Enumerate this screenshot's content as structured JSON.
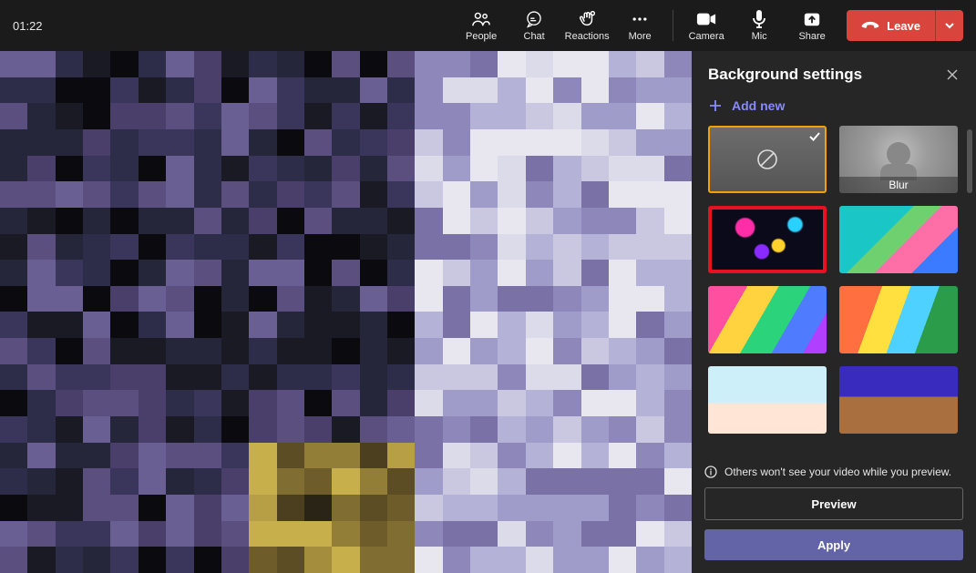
{
  "call": {
    "duration": "01:22"
  },
  "toolbar": {
    "people": "People",
    "chat": "Chat",
    "reactions": "Reactions",
    "more": "More",
    "camera": "Camera",
    "mic": "Mic",
    "share": "Share",
    "leave": "Leave"
  },
  "panel": {
    "title": "Background settings",
    "add_new": "Add new",
    "thumbs": [
      {
        "name": "none",
        "label": "",
        "selected": true,
        "highlighted": false
      },
      {
        "name": "blur",
        "label": "Blur",
        "selected": false,
        "highlighted": false
      },
      {
        "name": "image-1",
        "label": "",
        "selected": false,
        "highlighted": true
      },
      {
        "name": "image-2",
        "label": "",
        "selected": false,
        "highlighted": false
      },
      {
        "name": "image-3",
        "label": "",
        "selected": false,
        "highlighted": false
      },
      {
        "name": "image-4",
        "label": "",
        "selected": false,
        "highlighted": false
      },
      {
        "name": "image-5",
        "label": "",
        "selected": false,
        "highlighted": false
      },
      {
        "name": "image-6",
        "label": "",
        "selected": false,
        "highlighted": false
      }
    ],
    "info": "Others won't see your video while you preview.",
    "preview_btn": "Preview",
    "apply_btn": "Apply"
  }
}
